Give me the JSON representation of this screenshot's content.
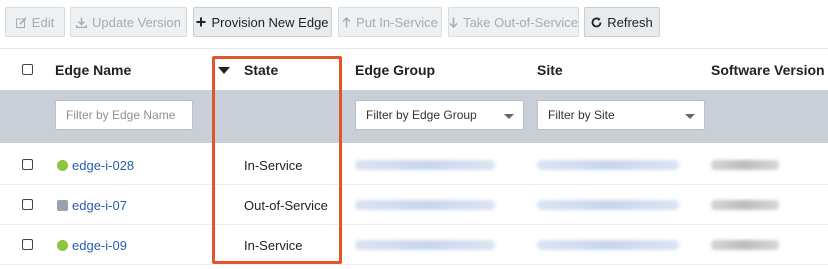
{
  "toolbar": {
    "edit": "Edit",
    "update_version": "Update Version",
    "provision_new_edge": "Provision New Edge",
    "put_in_service": "Put In-Service",
    "take_out_of_service": "Take Out-of-Service",
    "refresh": "Refresh"
  },
  "table": {
    "columns": {
      "edge_name": "Edge Name",
      "state": "State",
      "edge_group": "Edge Group",
      "site": "Site",
      "software_version": "Software Version"
    },
    "filters": {
      "edge_name_placeholder": "Filter by Edge Name",
      "edge_group": "Filter by Edge Group",
      "site": "Filter by Site"
    },
    "rows": [
      {
        "edge_name": "edge-i-028",
        "status": "online",
        "state": "In-Service"
      },
      {
        "edge_name": "edge-i-07",
        "status": "offline",
        "state": "Out-of-Service"
      },
      {
        "edge_name": "edge-i-09",
        "status": "online",
        "state": "In-Service"
      }
    ]
  },
  "colors": {
    "highlight": "#e0562a",
    "link": "#2a5db0",
    "online": "#8dc63f",
    "offline": "#9aa3ad",
    "filter_row": "#c9cfd6"
  }
}
